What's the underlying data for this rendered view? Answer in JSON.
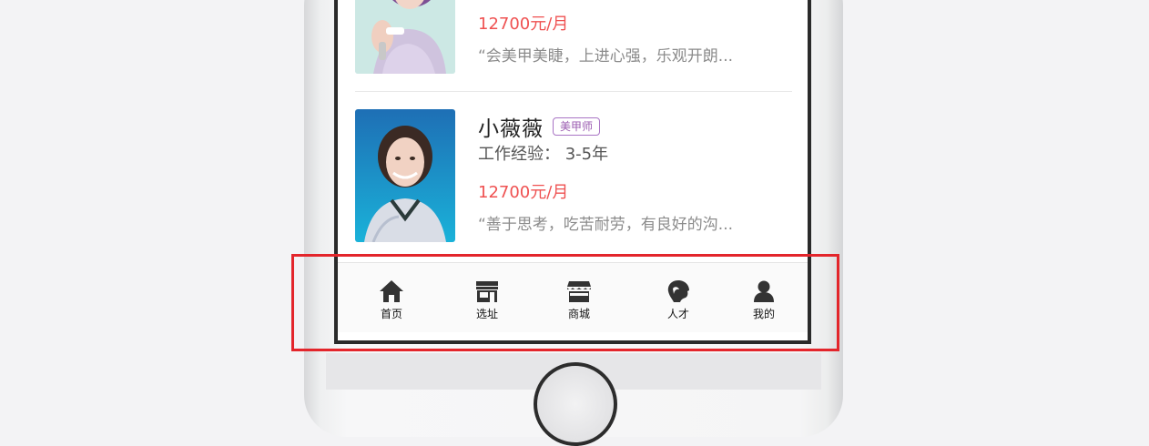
{
  "listing": {
    "cards": [
      {
        "name": "",
        "tag": "",
        "experience": "",
        "salary": "12700元/月",
        "quote": "“会美甲美睫，上进心强，乐观开朗..."
      },
      {
        "name": "小薇薇",
        "tag": "美甲师",
        "experience": "工作经验：  3-5年",
        "salary": "12700元/月",
        "quote": "“善于思考，吃苦耐劳，有良好的沟..."
      }
    ]
  },
  "tabbar": {
    "items": [
      {
        "label": "首页",
        "icon": "home-icon"
      },
      {
        "label": "选址",
        "icon": "storefront-icon"
      },
      {
        "label": "商城",
        "icon": "shop-awning-icon"
      },
      {
        "label": "人才",
        "icon": "person-head-icon"
      },
      {
        "label": "我的",
        "icon": "user-icon"
      }
    ]
  },
  "colors": {
    "salary": "#ef5151",
    "tag_border": "#a874c4",
    "highlight": "#e3252b"
  }
}
